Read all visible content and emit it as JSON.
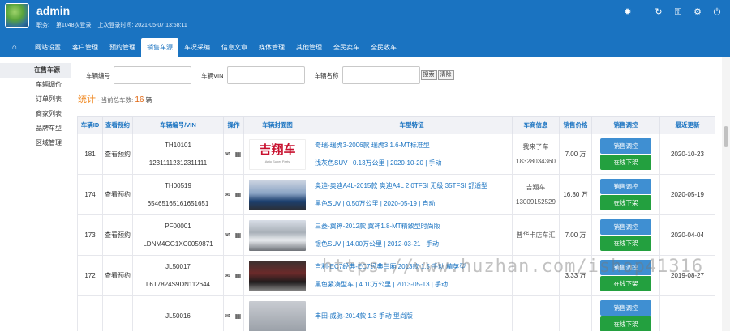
{
  "header": {
    "username": "admin",
    "role_label": "职务:",
    "login_count": "第1048次登录",
    "last_login": "上次登录时间: 2021-05-07 13:58:11"
  },
  "nav": {
    "items": [
      {
        "label": "网站设置"
      },
      {
        "label": "客户管理"
      },
      {
        "label": "预约管理"
      },
      {
        "label": "销售车源"
      },
      {
        "label": "车况采编"
      },
      {
        "label": "信息文章"
      },
      {
        "label": "媒体管理"
      },
      {
        "label": "其他管理"
      },
      {
        "label": "全民卖车"
      },
      {
        "label": "全民收车"
      }
    ],
    "active_index": 3
  },
  "sidebar": {
    "items": [
      {
        "label": "在售车源"
      },
      {
        "label": "车辆调价"
      },
      {
        "label": "订单列表"
      },
      {
        "label": "商家列表"
      },
      {
        "label": "品牌车型"
      },
      {
        "label": "区域管理"
      }
    ]
  },
  "search": {
    "code_label": "车辆编号",
    "vin_label": "车辆VIN",
    "name_label": "车辆名称",
    "search_btn": "搜索",
    "clear_btn": "清除"
  },
  "stats": {
    "title": "统计",
    "text": "- 当前总车数:",
    "count": "16",
    "unit": "辆"
  },
  "table": {
    "headers": [
      "车辆ID",
      "查看预约",
      "车辆编号/VIN",
      "操作",
      "车辆封面图",
      "车型特征",
      "车商信息",
      "销售价格",
      "销售调控",
      "最近更新"
    ],
    "rows": [
      {
        "id": "181",
        "appt": "查看预约",
        "code": "TH10101",
        "vin": "12311112312311111",
        "feat1": "奇瑞-瑞虎3-2006款 瑞虎3 1.6-MT标准型",
        "feat2": "浅灰色SUV | 0.13万公里 | 2020-10-20 | 手动",
        "dealer1": "我来了车",
        "dealer2": "18328034360",
        "price": "7.00",
        "price_unit": "万",
        "updated": "2020-10-23",
        "cover": "logo"
      },
      {
        "id": "174",
        "appt": "查看预约",
        "code": "TH00519",
        "vin": "65465165161651651",
        "feat1": "奥迪-奥迪A4L-2015款 奥迪A4L 2.0TFSI 无级 35TFSI 舒适型",
        "feat2": "黑色SUV | 0.50万公里 | 2020-05-19 | 自动",
        "dealer1": "吉翔车",
        "dealer2": "13009152529",
        "price": "16.80",
        "price_unit": "万",
        "updated": "2020-05-19",
        "cover": "car1"
      },
      {
        "id": "173",
        "appt": "查看预约",
        "code": "PF00001",
        "vin": "LDNM4GG1XC0059871",
        "feat1": "三菱-翼神-2012款 翼神1.8-MT精致型时尚版",
        "feat2": "银色SUV | 14.00万公里 | 2012-03-21 | 手动",
        "dealer1": "普华卡店车汇",
        "dealer2": "",
        "price": "7.00",
        "price_unit": "万",
        "updated": "2020-04-04",
        "cover": "car2"
      },
      {
        "id": "172",
        "appt": "查看预约",
        "code": "JL50017",
        "vin": "L6T7824S9DN112644",
        "feat1": "吉利-EC7经典-EC7经典三厢 2013款 1.5 手动 精英型",
        "feat2": "黑色紧凑型车 | 4.10万公里 | 2013-05-13 | 手动",
        "dealer1": "",
        "dealer2": "",
        "price": "3.33",
        "price_unit": "万",
        "updated": "2019-08-27",
        "cover": "car3"
      },
      {
        "id": "",
        "appt": "",
        "code": "JL50016",
        "vin": "",
        "feat1": "丰田-威驰-2014款 1.3 手动 型尚版",
        "feat2": "",
        "dealer1": "",
        "dealer2": "",
        "price": "",
        "price_unit": "",
        "updated": "",
        "cover": "car4"
      }
    ],
    "logo_text": "吉翔车",
    "logo_sub": "Auto Super Party",
    "btn_price": "销售调控",
    "btn_offline": "在线下架"
  },
  "watermark": "https://www.huzhan.com/ishop41316",
  "colors": {
    "primary": "#1a73c1",
    "accent": "#e0650f",
    "offline_btn": "#23a03f",
    "price_btn": "#3f8fd2"
  }
}
